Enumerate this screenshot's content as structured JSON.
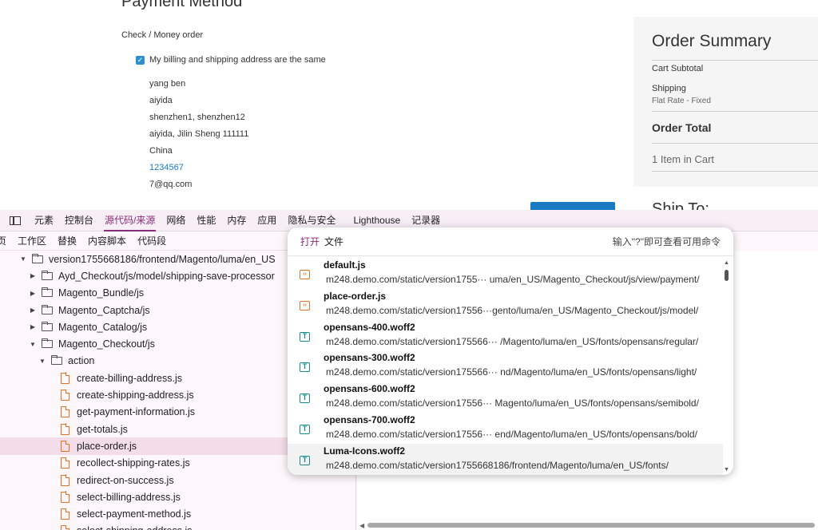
{
  "checkout": {
    "section_title": "Payment Method",
    "method": "Check / Money order",
    "same_address_label": "My billing and shipping address are the same",
    "address": {
      "name": "yang ben",
      "company": "aiyida",
      "street": "shenzhen1, shenzhen12",
      "city_line": "aiyida, Jilin Sheng 111111",
      "country": "China",
      "phone": "1234567",
      "email": "7@qq.com"
    }
  },
  "summary": {
    "title": "Order Summary",
    "cart_subtotal": "Cart Subtotal",
    "shipping": "Shipping",
    "shipping_method": "Flat Rate - Fixed",
    "order_total": "Order Total",
    "items_in_cart": "1 Item in Cart",
    "ship_to": "Ship To:"
  },
  "devtools": {
    "tabs": [
      "元素",
      "控制台",
      "源代码/来源",
      "网络",
      "性能",
      "内存",
      "应用",
      "隐私与安全",
      "Lighthouse",
      "记录器"
    ],
    "active_tab": "源代码/来源",
    "subtabs": [
      "页",
      "工作区",
      "替换",
      "内容脚本",
      "代码段"
    ],
    "tree": [
      {
        "label": "version1755668186/frontend/Magento/luma/en_US",
        "type": "folder",
        "level": 1,
        "expanded": true
      },
      {
        "label": "Ayd_Checkout/js/model/shipping-save-processor",
        "type": "folder",
        "level": 2,
        "expanded": false
      },
      {
        "label": "Magento_Bundle/js",
        "type": "folder",
        "level": 2,
        "expanded": false
      },
      {
        "label": "Magento_Captcha/js",
        "type": "folder",
        "level": 2,
        "expanded": false
      },
      {
        "label": "Magento_Catalog/js",
        "type": "folder",
        "level": 2,
        "expanded": false
      },
      {
        "label": "Magento_Checkout/js",
        "type": "folder",
        "level": 2,
        "expanded": true
      },
      {
        "label": "action",
        "type": "folder",
        "level": 3,
        "expanded": true
      },
      {
        "label": "create-billing-address.js",
        "type": "file",
        "level": 4
      },
      {
        "label": "create-shipping-address.js",
        "type": "file",
        "level": 4
      },
      {
        "label": "get-payment-information.js",
        "type": "file",
        "level": 4
      },
      {
        "label": "get-totals.js",
        "type": "file",
        "level": 4
      },
      {
        "label": "place-order.js",
        "type": "file",
        "level": 4,
        "selected": true
      },
      {
        "label": "recollect-shipping-rates.js",
        "type": "file",
        "level": 4
      },
      {
        "label": "redirect-on-success.js",
        "type": "file",
        "level": 4
      },
      {
        "label": "select-billing-address.js",
        "type": "file",
        "level": 4
      },
      {
        "label": "select-payment-method.js",
        "type": "file",
        "level": 4
      },
      {
        "label": "select-shipping-address.js",
        "type": "file",
        "level": 4
      }
    ]
  },
  "palette": {
    "prefix": "打开",
    "query": "文件",
    "hint": "输入\"?\"即可查看可用命令",
    "results": [
      {
        "name": "default.js",
        "path": "m248.demo.com/static/version1755··· uma/en_US/Magento_Checkout/js/view/payment/",
        "icon": "script-icon"
      },
      {
        "name": "place-order.js",
        "path": "m248.demo.com/static/version17556···gento/luma/en_US/Magento_Checkout/js/model/",
        "icon": "script-icon"
      },
      {
        "name": "opensans-400.woff2",
        "path": "m248.demo.com/static/version175566··· /Magento/luma/en_US/fonts/opensans/regular/",
        "icon": "font-icon"
      },
      {
        "name": "opensans-300.woff2",
        "path": "m248.demo.com/static/version175566··· nd/Magento/luma/en_US/fonts/opensans/light/",
        "icon": "font-icon"
      },
      {
        "name": "opensans-600.woff2",
        "path": "m248.demo.com/static/version17556··· Magento/luma/en_US/fonts/opensans/semibold/",
        "icon": "font-icon"
      },
      {
        "name": "opensans-700.woff2",
        "path": "m248.demo.com/static/version17556··· end/Magento/luma/en_US/fonts/opensans/bold/",
        "icon": "font-icon"
      },
      {
        "name": "Luma-Icons.woff2",
        "path": "m248.demo.com/static/version1755668186/frontend/Magento/luma/en_US/fonts/",
        "icon": "font-icon",
        "hover": true
      }
    ]
  },
  "colors": {
    "accent": "#8a2c7c",
    "link": "#1979c3",
    "file_icon": "#e8711f",
    "font_icon": "#138e8c"
  }
}
